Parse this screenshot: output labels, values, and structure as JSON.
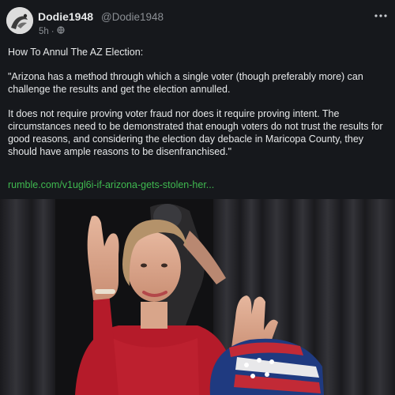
{
  "post": {
    "author_name": "Dodie1948",
    "author_handle": "@Dodie1948",
    "time": "5h",
    "separator": "·",
    "more_icon": "more-horizontal-icon",
    "paragraphs": [
      "How To Annul The AZ Election:",
      "\"Arizona has a method through which a single voter (though preferably more) can challenge the results and get the election annulled.",
      "It does not require proving voter fraud nor does it require proving intent. The circumstances need to be demonstrated that enough voters do not trust the results for good reasons, and considering the election day debacle in Maricopa County, they should have ample reasons to be disenfranchised.\""
    ],
    "link": "rumble.com/v1ugl6i-if-arizona-gets-stolen-her...",
    "colors": {
      "background": "#16181c",
      "text": "#e7e9ea",
      "muted": "#8b8f94",
      "link": "#3fb950"
    }
  }
}
